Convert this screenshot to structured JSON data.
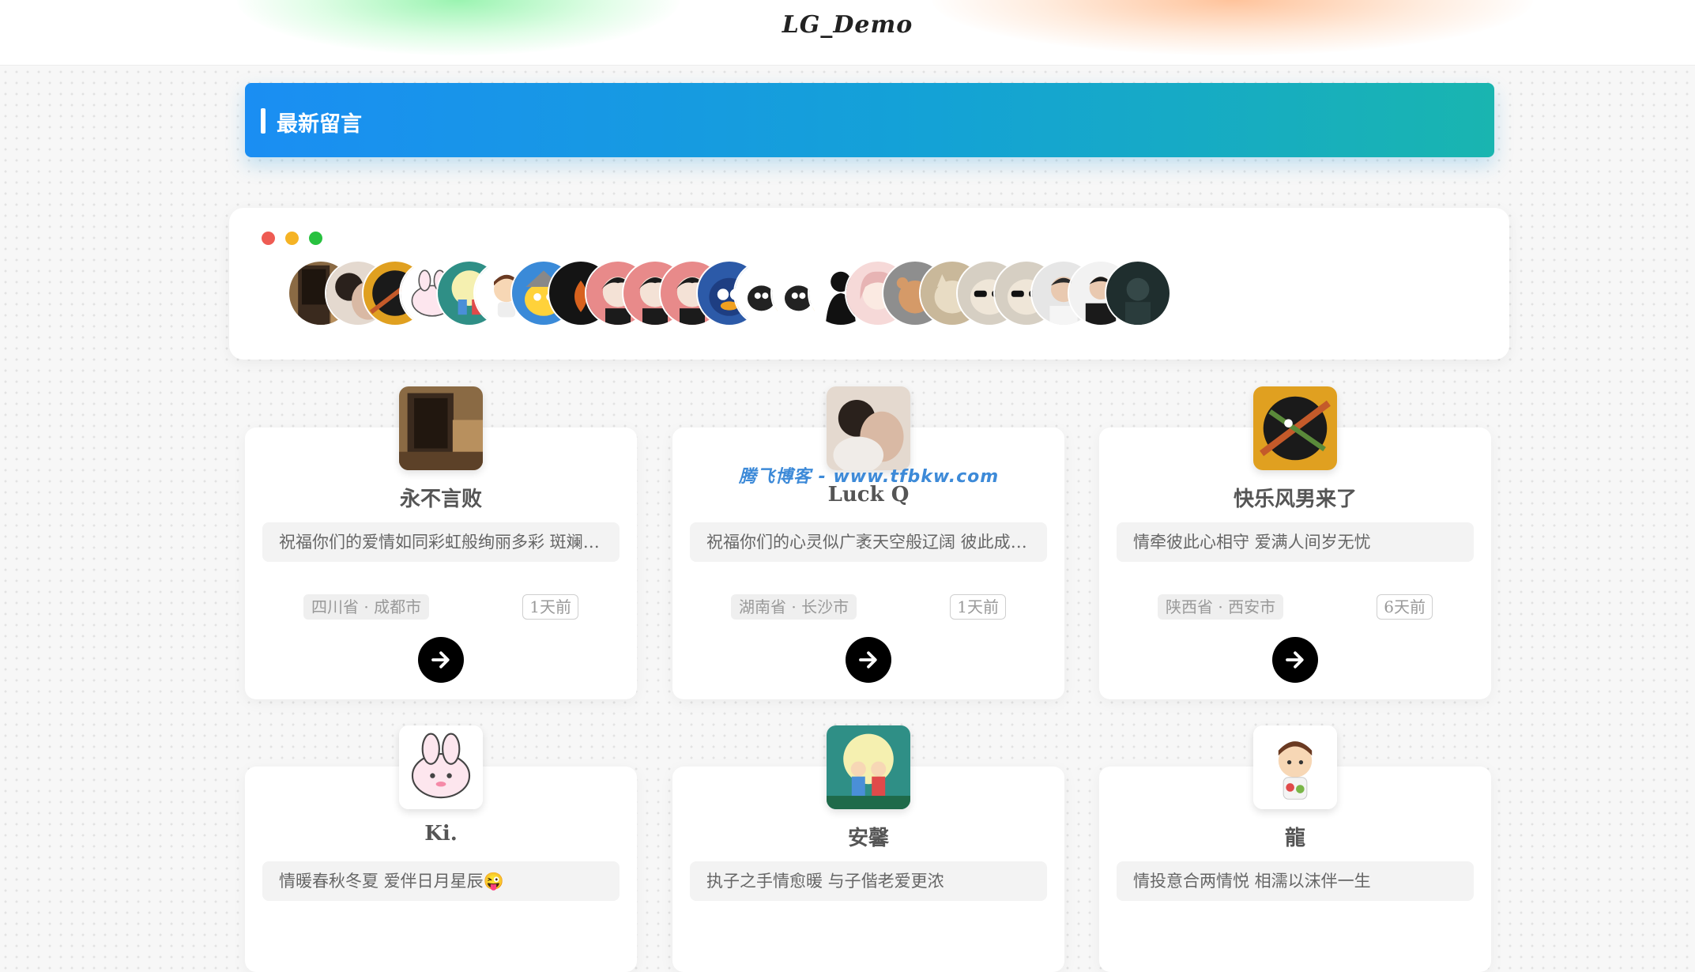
{
  "header": {
    "logo": "LG_Demo"
  },
  "banner": {
    "title": "最新留言"
  },
  "avatar_strip": {
    "window_dots": [
      "red",
      "yellow",
      "green"
    ],
    "avatars": [
      "room-photo-avatar",
      "couple-photo-avatar",
      "cartoon-warrior-avatar",
      "bunny-sticker-avatar",
      "couple-moon-avatar",
      "chibi-boy-avatar",
      "viking-bird-avatar",
      "dark-fire-avatar",
      "anime-boy-avatar",
      "anime-boy-avatar",
      "anime-boy-avatar",
      "captain-bird-avatar",
      "black-cat-beer-avatar",
      "black-cat-beer-avatar",
      "silhouette-avatar",
      "anime-girl-avatar",
      "teddy-bear-avatar",
      "cat-photo-avatar",
      "sunglasses-cat-avatar",
      "sunglasses-cat-avatar",
      "man-portrait-avatar",
      "man-black-avatar",
      "dark-figure-avatar"
    ]
  },
  "watermark": "腾飞博客 - www.tfbkw.com",
  "cards": [
    {
      "name": "永不言败",
      "message": "祝福你们的爱情如同彩虹般绚丽多彩 斑斓多姿",
      "location": "四川省 · 成都市",
      "time": "1天前",
      "avatar_icon": "room-photo-avatar"
    },
    {
      "name": "Luck Q",
      "message": "祝福你们的心灵似广袤天空般辽阔 彼此成为依靠",
      "location": "湖南省 · 长沙市",
      "time": "1天前",
      "avatar_icon": "couple-photo-avatar"
    },
    {
      "name": "快乐风男来了",
      "message": "情牵彼此心相守 爱满人间岁无忧",
      "location": "陕西省 · 西安市",
      "time": "6天前",
      "avatar_icon": "cartoon-warrior-avatar"
    },
    {
      "name": "Ki.",
      "message": "情暖春秋冬夏 爱伴日月星辰😜",
      "avatar_icon": "bunny-sticker-avatar"
    },
    {
      "name": "安馨",
      "message": "执子之手情愈暖 与子偕老爱更浓",
      "avatar_icon": "couple-moon-avatar"
    },
    {
      "name": "龍",
      "message": "情投意合两情悦 相濡以沫伴一生",
      "avatar_icon": "chibi-boy-avatar"
    }
  ]
}
